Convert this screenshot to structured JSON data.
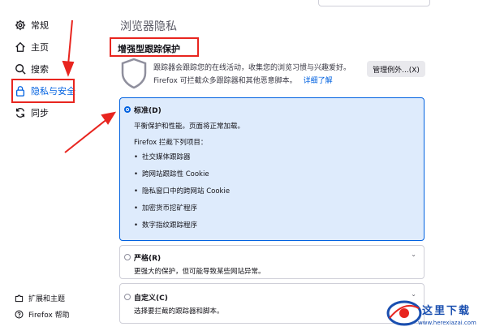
{
  "sidebar": {
    "items": [
      {
        "label": "常规",
        "icon": "gear-icon"
      },
      {
        "label": "主页",
        "icon": "home-icon"
      },
      {
        "label": "搜索",
        "icon": "search-icon"
      },
      {
        "label": "隐私与安全",
        "icon": "lock-icon",
        "active": true
      },
      {
        "label": "同步",
        "icon": "sync-icon"
      }
    ],
    "bottom": [
      {
        "label": "扩展和主题",
        "icon": "puzzle-icon"
      },
      {
        "label": "Firefox 帮助",
        "icon": "help-icon"
      }
    ]
  },
  "main": {
    "page_title": "浏览器隐私",
    "section_title": "增强型跟踪保护",
    "desc_line1": "跟踪器会跟踪您的在线活动，收集您的浏览习惯与兴趣爱好。",
    "desc_line2": "Firefox 可拦截众多跟踪器和其他恶意脚本。",
    "learn_more": "详细了解",
    "exceptions_button": "管理例外...(X)"
  },
  "options": {
    "standard": {
      "label": "标准(D)",
      "desc": "平衡保护和性能。页面将正常加载。",
      "blocks_intro": "Firefox 拦截下列项目：",
      "items": [
        "社交媒体跟踪器",
        "跨网站跟踪性 Cookie",
        "隐私窗口中的跨网站 Cookie",
        "加密货币挖矿程序",
        "数字指纹跟踪程序"
      ]
    },
    "strict": {
      "label": "严格(R)",
      "desc": "更强大的保护，但可能导致某些网站异常。"
    },
    "custom": {
      "label": "自定义(C)",
      "desc": "选择要拦截的跟踪器和脚本。"
    }
  },
  "watermark": {
    "text": "这里下载",
    "url": "www.herexiazai.com"
  },
  "colors": {
    "accent": "#0061e0",
    "annotation_red": "#e8251f",
    "selected_card_bg": "#deebfc"
  }
}
